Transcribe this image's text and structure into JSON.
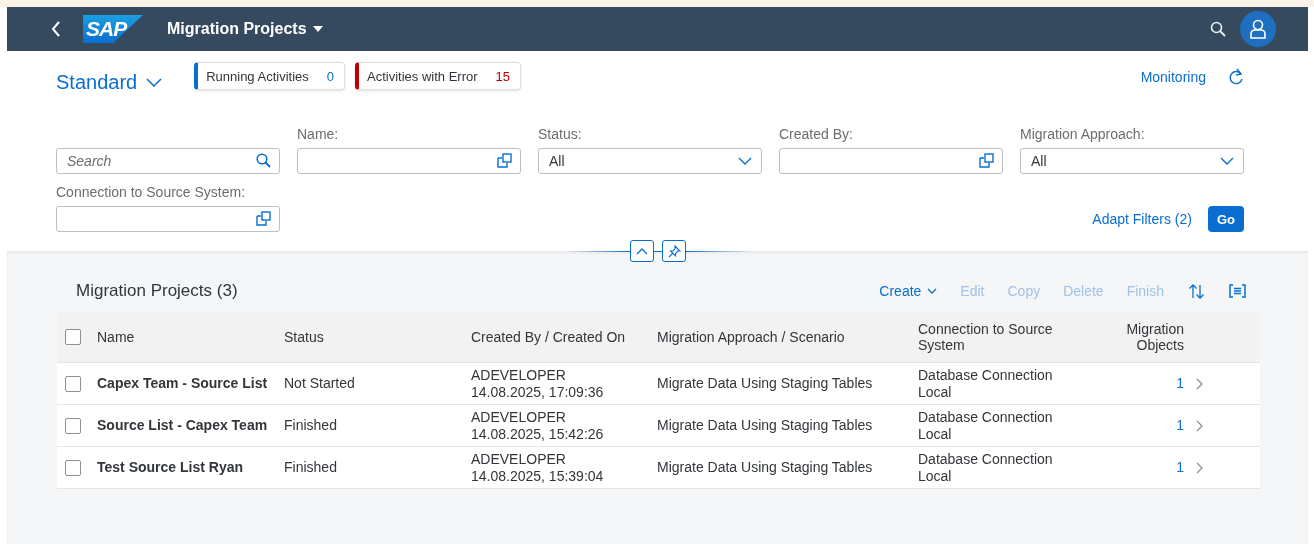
{
  "shell": {
    "logo": "SAP",
    "title": "Migration Projects"
  },
  "header": {
    "variant": "Standard",
    "indicators": [
      {
        "label": "Running Activities",
        "count": "0",
        "color": "#0a6ed1"
      },
      {
        "label": "Activities with Error",
        "count": "15",
        "color": "#bb0000"
      }
    ],
    "link": "Monitoring"
  },
  "filters": [
    {
      "kind": "search",
      "placeholder": "Search"
    },
    {
      "kind": "valuehelp",
      "label": "Name:"
    },
    {
      "kind": "select",
      "label": "Status:",
      "value": "All"
    },
    {
      "kind": "valuehelp",
      "label": "Created By:"
    },
    {
      "kind": "select",
      "label": "Migration Approach:",
      "value": "All"
    },
    {
      "kind": "valuehelp",
      "label": "Connection to Source System:"
    }
  ],
  "adapt_filters": "Adapt Filters (2)",
  "go": "Go",
  "table": {
    "title": "Migration Projects (3)",
    "actions": [
      {
        "kind": "menu",
        "label": "Create",
        "disabled": false
      },
      {
        "kind": "button",
        "label": "Edit",
        "disabled": true
      },
      {
        "kind": "button",
        "label": "Copy",
        "disabled": true
      },
      {
        "kind": "button",
        "label": "Delete",
        "disabled": true
      },
      {
        "kind": "button",
        "label": "Finish",
        "disabled": true
      }
    ],
    "all_selected": false,
    "columns": [
      "Name",
      "Status",
      "Created By / Created On",
      "Migration Approach / Scenario",
      "Connection to Source System",
      "Migration Objects"
    ],
    "rows": [
      {
        "selected": false,
        "name": "Capex Team - Source List",
        "status": "Not Started",
        "created_by": "ADEVELOPER",
        "created_on": "14.08.2025, 17:09:36",
        "approach": "Migrate Data Using Staging Tables",
        "connection": "Database Connection Local",
        "objects": "1"
      },
      {
        "selected": false,
        "name": "Source List - Capex Team",
        "status": "Finished",
        "created_by": "ADEVELOPER",
        "created_on": "14.08.2025, 15:42:26",
        "approach": "Migrate Data Using Staging Tables",
        "connection": "Database Connection Local",
        "objects": "1"
      },
      {
        "selected": false,
        "name": "Test Source List Ryan",
        "status": "Finished",
        "created_by": "ADEVELOPER",
        "created_on": "14.08.2025, 15:39:04",
        "approach": "Migrate Data Using Staging Tables",
        "connection": "Database Connection Local",
        "objects": "1"
      }
    ]
  }
}
